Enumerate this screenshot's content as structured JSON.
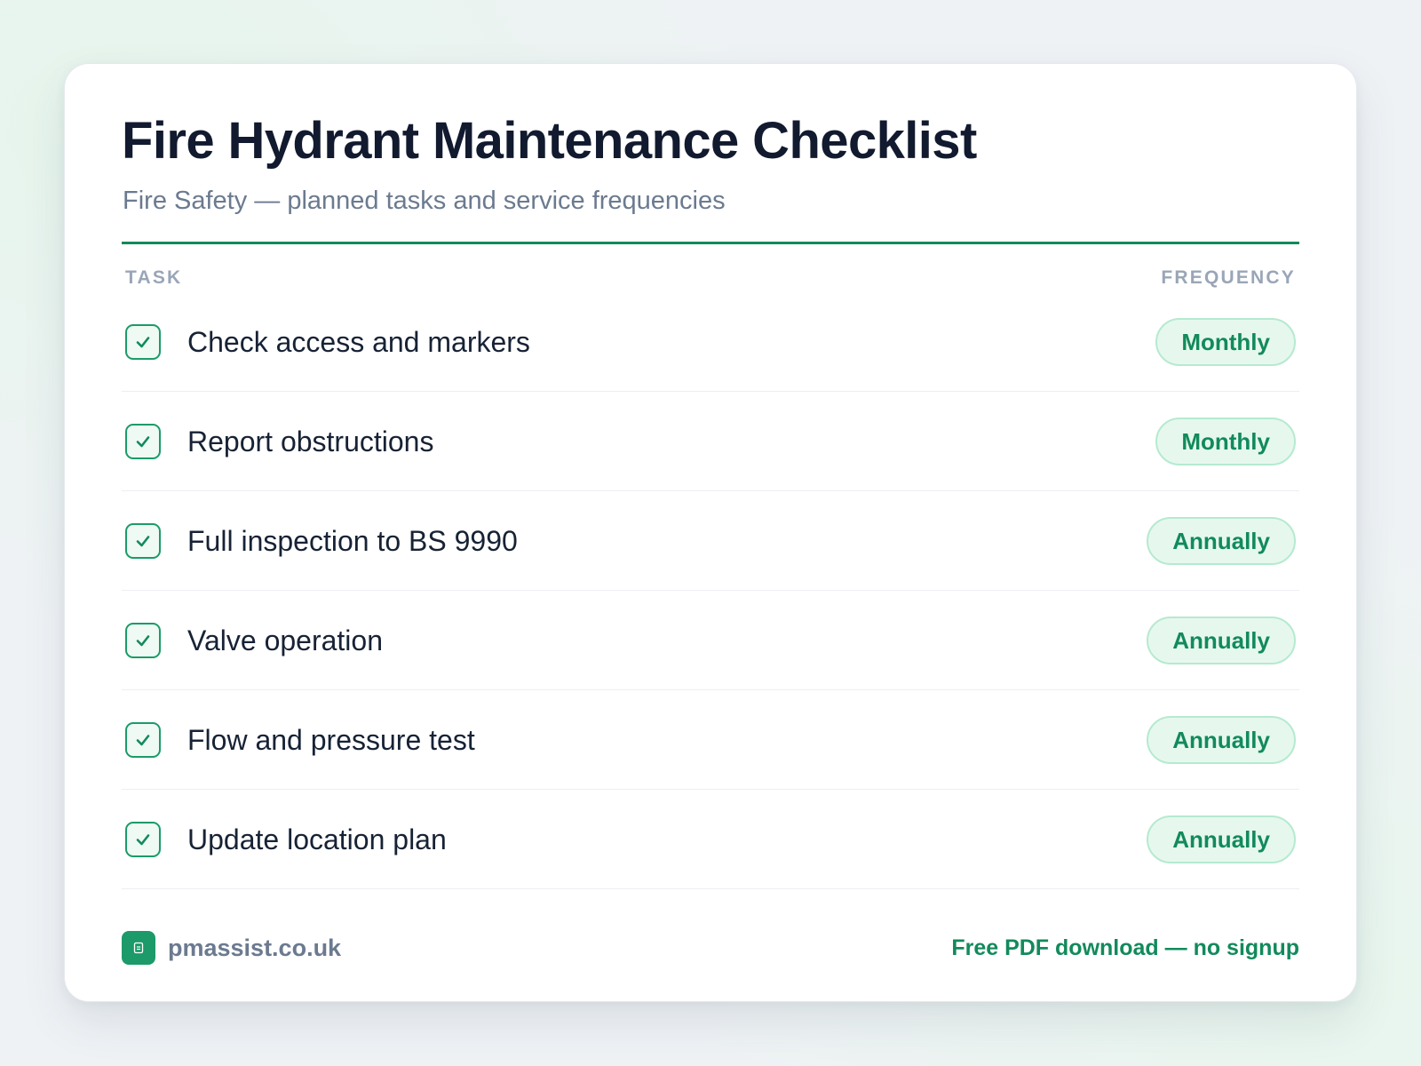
{
  "header": {
    "title": "Fire Hydrant Maintenance Checklist",
    "subtitle": "Fire Safety — planned tasks and service frequencies"
  },
  "columns": {
    "task": "TASK",
    "frequency": "FREQUENCY"
  },
  "tasks": [
    {
      "label": "Check access and markers",
      "frequency": "Monthly",
      "checked": true
    },
    {
      "label": "Report obstructions",
      "frequency": "Monthly",
      "checked": true
    },
    {
      "label": "Full inspection to BS 9990",
      "frequency": "Annually",
      "checked": true
    },
    {
      "label": "Valve operation",
      "frequency": "Annually",
      "checked": true
    },
    {
      "label": "Flow and pressure test",
      "frequency": "Annually",
      "checked": true
    },
    {
      "label": "Update location plan",
      "frequency": "Annually",
      "checked": true
    }
  ],
  "footer": {
    "site": "pmassist.co.uk",
    "cta": "Free PDF download — no signup",
    "logo_icon": "document-icon"
  },
  "colors": {
    "accent": "#128a5c",
    "badge_bg": "#e6f8ee",
    "badge_border": "#b5ead0",
    "title": "#111a2e",
    "muted": "#6b7a8f"
  },
  "icons": {
    "checkbox": "check-icon"
  }
}
